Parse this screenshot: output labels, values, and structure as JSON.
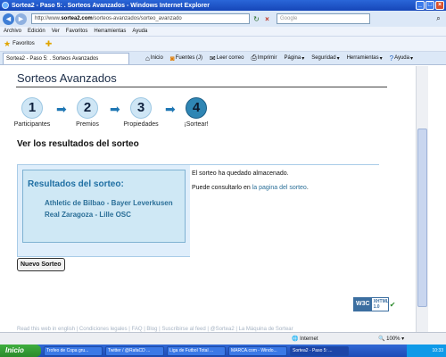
{
  "window": {
    "title": "Sortea2 - Paso 5: . Sorteos Avanzados - Windows Internet Explorer"
  },
  "address": {
    "url_prefix": "http://www.",
    "url_domain": "sortea2.com",
    "url_rest": "/sorteos-avanzados/sorteo_avanzado",
    "search_placeholder": "Google"
  },
  "menu": [
    "Archivo",
    "Edición",
    "Ver",
    "Favoritos",
    "Herramientas",
    "Ayuda"
  ],
  "favorites": {
    "label": "Favoritos"
  },
  "tab": {
    "label": "Sortea2 - Paso 5: . Sorteos Avanzados"
  },
  "commands": [
    {
      "icon": "home-icon",
      "label": "Inicio"
    },
    {
      "icon": "feeds-icon",
      "label": "Fuentes (J)"
    },
    {
      "icon": "mail-icon",
      "label": "Leer correo"
    },
    {
      "icon": "print-icon",
      "label": "Imprimir"
    },
    {
      "icon": "page-icon",
      "label": "Página"
    },
    {
      "icon": "safety-icon",
      "label": "Seguridad"
    },
    {
      "icon": "tools-icon",
      "label": "Herramientas"
    },
    {
      "icon": "help-icon",
      "label": "Ayuda"
    }
  ],
  "page": {
    "heading": "Sorteos Avanzados",
    "steps": [
      {
        "number": "1",
        "label": "Participantes"
      },
      {
        "number": "2",
        "label": "Premios"
      },
      {
        "number": "3",
        "label": "Propiedades"
      },
      {
        "number": "4",
        "label": "¡Sortear!"
      }
    ],
    "subheading": "Ver los resultados del sorteo",
    "results_title": "Resultados del sorteo:",
    "matches": [
      "Athletic de Bilbao - Bayer Leverkusen",
      "Real Zaragoza - Lille OSC"
    ],
    "saved_message": "El sorteo ha quedado almacenado.",
    "consult_text": "Puede consultarlo en ",
    "consult_link": "la pagina del sorteo",
    "consult_end": ".",
    "new_button": "Nuevo Sorteo",
    "badge_w3c": "W3C",
    "badge_xhtml": "XHTML",
    "badge_version": "1.0",
    "footer": "Read this web in english | Condiciones legales | FAQ | Blog | Suscribirse al feed | @Sortea2 | La Máquina de Sortear"
  },
  "status": {
    "zone": "Internet",
    "zoom": "100%"
  },
  "taskbar": {
    "start": "Inicio",
    "items": [
      "Trofeo de Copa gru...",
      "Twitter / @RafaCD ...",
      "Liga de Futbol Total ...",
      "MARCA.com - Windo...",
      "Sortea2 - Paso 5: ..."
    ],
    "clock": "10:33"
  }
}
